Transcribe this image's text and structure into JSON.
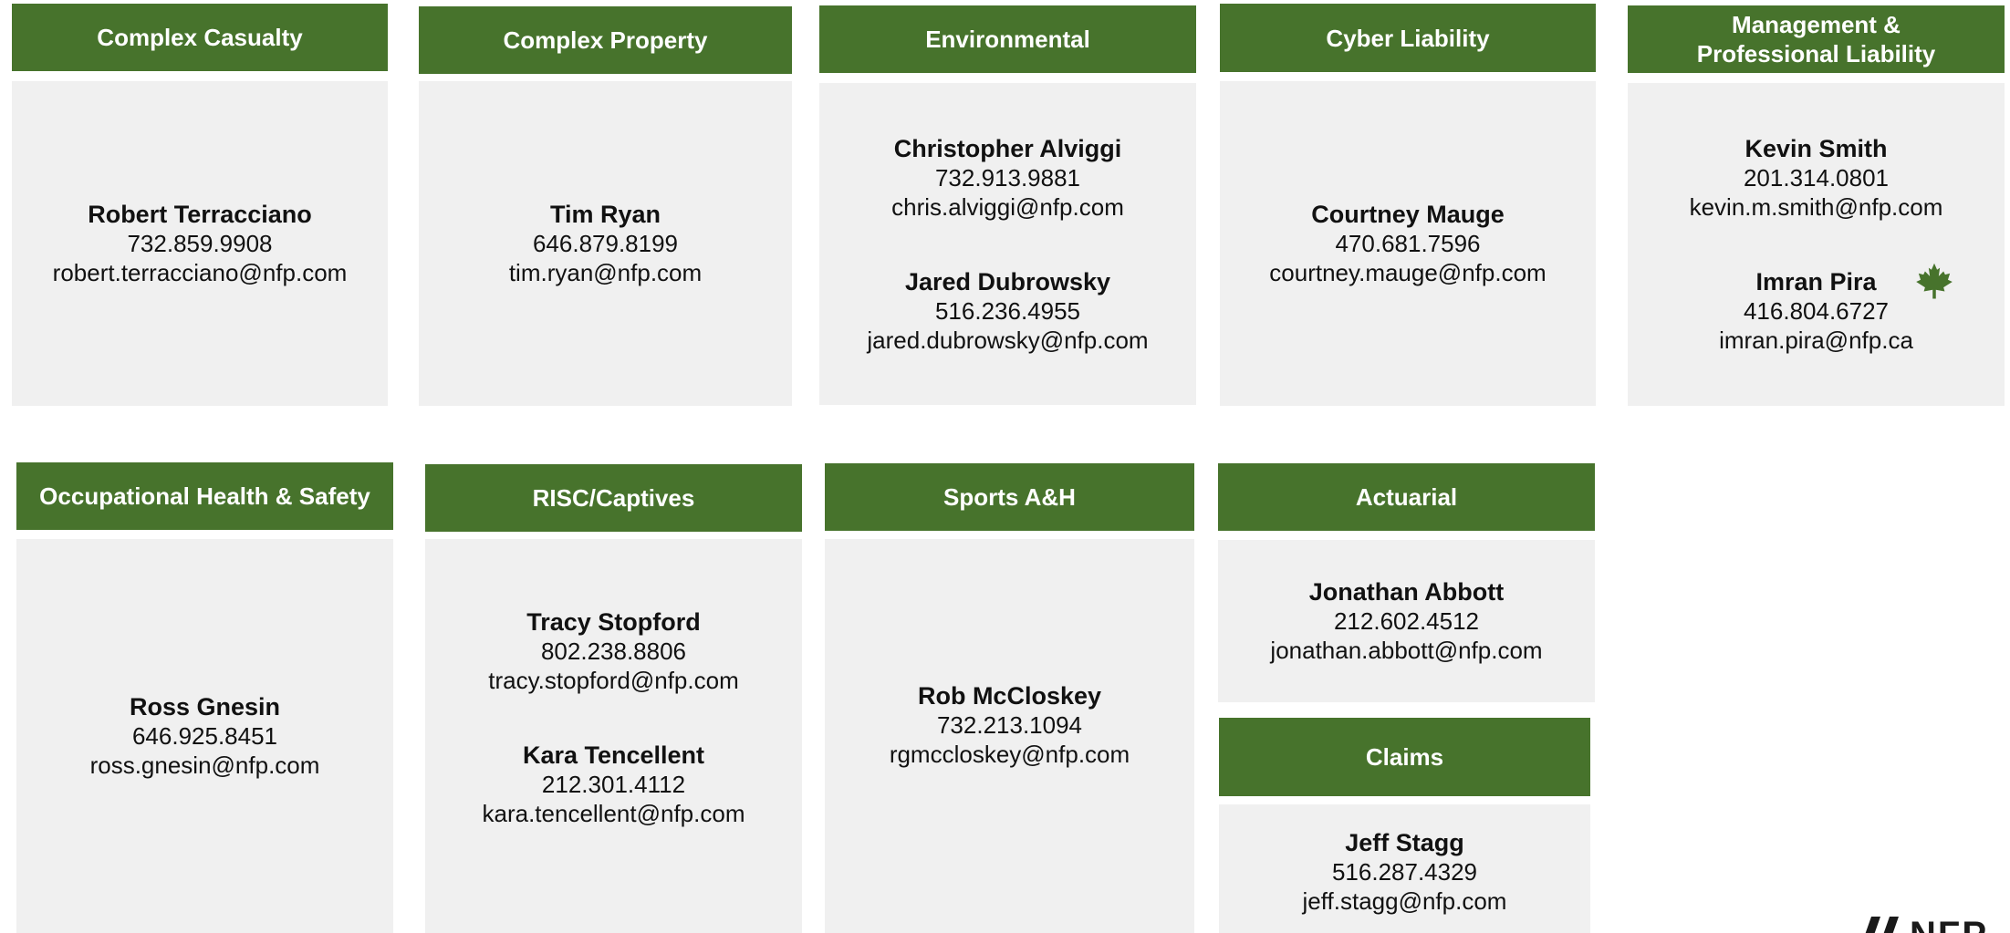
{
  "accent_color": "#47732c",
  "panel_color": "#f0f0f0",
  "sections": {
    "complex_casualty": {
      "title": "Complex Casualty",
      "contacts": [
        {
          "name": "Robert Terracciano",
          "phone": "732.859.9908",
          "email": "robert.terracciano@nfp.com"
        }
      ]
    },
    "complex_property": {
      "title": "Complex Property",
      "contacts": [
        {
          "name": "Tim Ryan",
          "phone": "646.879.8199",
          "email": "tim.ryan@nfp.com"
        }
      ]
    },
    "environmental": {
      "title": "Environmental",
      "contacts": [
        {
          "name": "Christopher Alviggi",
          "phone": "732.913.9881",
          "email": "chris.alviggi@nfp.com"
        },
        {
          "name": "Jared Dubrowsky",
          "phone": "516.236.4955",
          "email": "jared.dubrowsky@nfp.com"
        }
      ]
    },
    "cyber_liability": {
      "title": "Cyber Liability",
      "contacts": [
        {
          "name": "Courtney Mauge",
          "phone": "470.681.7596",
          "email": "courtney.mauge@nfp.com"
        }
      ]
    },
    "management_professional": {
      "title_line1": "Management &",
      "title_line2": "Professional Liability",
      "contacts": [
        {
          "name": "Kevin Smith",
          "phone": "201.314.0801",
          "email": "kevin.m.smith@nfp.com"
        },
        {
          "name": "Imran Pira",
          "phone": "416.804.6727",
          "email": "imran.pira@nfp.ca",
          "icon": "maple-leaf-icon"
        }
      ]
    },
    "occupational_health": {
      "title": "Occupational Health & Safety",
      "contacts": [
        {
          "name": "Ross Gnesin",
          "phone": "646.925.8451",
          "email": "ross.gnesin@nfp.com"
        }
      ]
    },
    "risc_captives": {
      "title": "RISC/Captives",
      "contacts": [
        {
          "name": "Tracy Stopford",
          "phone": "802.238.8806",
          "email": "tracy.stopford@nfp.com"
        },
        {
          "name": "Kara Tencellent",
          "phone": "212.301.4112",
          "email": "kara.tencellent@nfp.com"
        }
      ]
    },
    "sports_ah": {
      "title": "Sports A&H",
      "contacts": [
        {
          "name": "Rob McCloskey",
          "phone": "732.213.1094",
          "email": "rgmccloskey@nfp.com"
        }
      ]
    },
    "actuarial": {
      "title": "Actuarial",
      "contacts": [
        {
          "name": "Jonathan Abbott",
          "phone": "212.602.4512",
          "email": "jonathan.abbott@nfp.com"
        }
      ]
    },
    "claims": {
      "title": "Claims",
      "contacts": [
        {
          "name": "Jeff Stagg",
          "phone": "516.287.4329",
          "email": "jeff.stagg@nfp.com"
        }
      ]
    }
  },
  "logo": {
    "text": "NFP",
    "icon": "nfp-logo-mark"
  }
}
